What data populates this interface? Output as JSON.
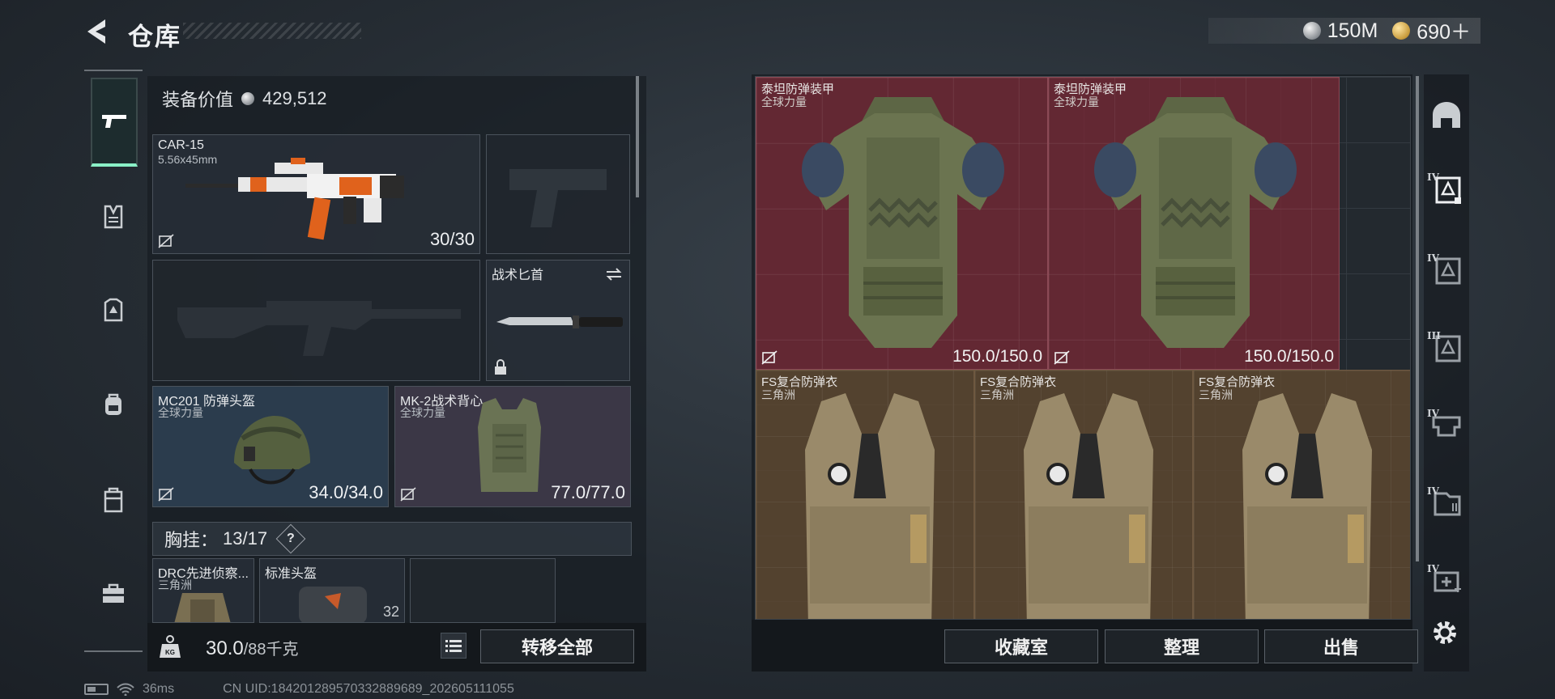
{
  "header": {
    "title": "仓库",
    "currencies": [
      {
        "icon": "silver-coin-icon",
        "value": "150M"
      },
      {
        "icon": "gold-coin-icon",
        "value": "690＋"
      }
    ]
  },
  "left_nav": [
    {
      "icon": "pistol-icon",
      "active": true
    },
    {
      "icon": "vest-icon"
    },
    {
      "icon": "armor-icon"
    },
    {
      "icon": "backpack-icon"
    },
    {
      "icon": "case-icon"
    },
    {
      "icon": "toolbox-icon"
    }
  ],
  "loadout": {
    "value_label": "装备价值",
    "value": "429,512",
    "primary": {
      "name": "CAR-15",
      "caliber": "5.56x45mm",
      "ammo": "30/30"
    },
    "melee": {
      "name": "战术匕首"
    },
    "helmet": {
      "name": "MC201 防弹头盔",
      "origin": "全球力量",
      "durability": "34.0/34.0"
    },
    "vest": {
      "name": "MK-2战术背心",
      "origin": "全球力量",
      "durability": "77.0/77.0"
    },
    "chest_rig": {
      "label": "胸挂：",
      "count": "13/17",
      "help": "?"
    },
    "rig_items": [
      {
        "name": "DRC先进侦察...",
        "origin": "三角洲"
      },
      {
        "name": "标准头盔",
        "count": "32"
      }
    ],
    "weight": {
      "current": "30.0",
      "max": "/88千克"
    },
    "transfer_all": "转移全部"
  },
  "storage": {
    "items": [
      {
        "name": "泰坦防弹装甲",
        "origin": "全球力量",
        "durability": "150.0/150.0"
      },
      {
        "name": "泰坦防弹装甲",
        "origin": "全球力量",
        "durability": "150.0/150.0"
      },
      {
        "name": "FS复合防弹衣",
        "origin": "三角洲"
      },
      {
        "name": "FS复合防弹衣",
        "origin": "三角洲"
      },
      {
        "name": "FS复合防弹衣",
        "origin": "三角洲"
      }
    ],
    "actions": {
      "collection": "收藏室",
      "sort": "整理",
      "sell": "出售"
    }
  },
  "filters": [
    {
      "icon": "helmet-filter-icon",
      "tier": ""
    },
    {
      "icon": "armor-filter-icon",
      "tier": "IV"
    },
    {
      "icon": "armor-filter-icon",
      "tier": "IV"
    },
    {
      "icon": "armor-filter-icon",
      "tier": "III"
    },
    {
      "icon": "rig-filter-icon",
      "tier": "IV"
    },
    {
      "icon": "container-filter-icon",
      "tier": "IV"
    },
    {
      "icon": "medkit-filter-icon",
      "tier": "IV"
    }
  ],
  "status": {
    "ping": "36ms",
    "uid": "CN UID:184201289570332889689_202605111055"
  },
  "colors": {
    "accent": "#8af0c6",
    "red_rarity": "#76283a",
    "gold_rarity": "#5f4830",
    "blue_rarity": "#2b3c4d",
    "purple_rarity": "#3b3746"
  }
}
